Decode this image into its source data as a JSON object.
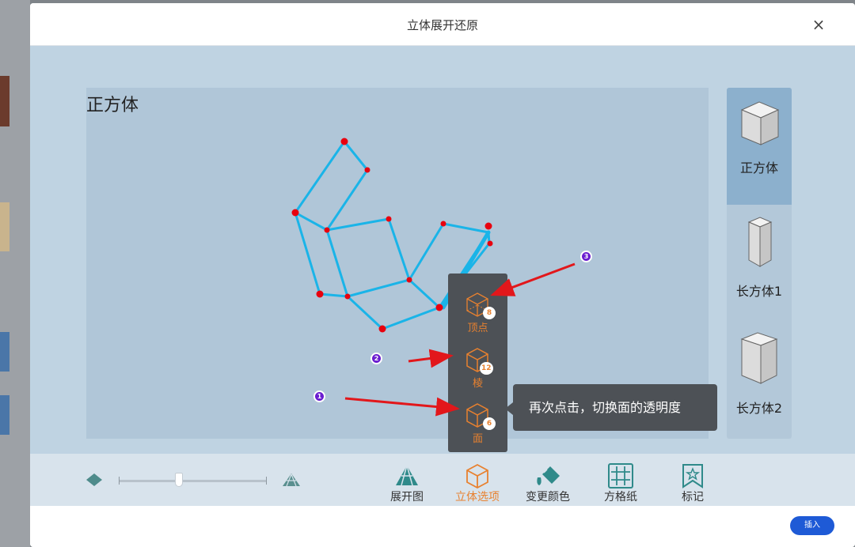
{
  "dialog": {
    "title": "立体展开还原",
    "close_glyph": "×"
  },
  "canvas": {
    "title": "正方体"
  },
  "shapes": [
    {
      "label": "正方体",
      "active": true
    },
    {
      "label": "长方体1",
      "active": false
    },
    {
      "label": "长方体2",
      "active": false
    }
  ],
  "toolbar": {
    "items": [
      {
        "label": "展开图",
        "icon": "unfold-icon"
      },
      {
        "label": "立体选项",
        "icon": "cube-options-icon",
        "active": true
      },
      {
        "label": "变更颜色",
        "icon": "paint-bucket-icon"
      },
      {
        "label": "方格纸",
        "icon": "grid-paper-icon"
      },
      {
        "label": "标记",
        "icon": "bookmark-star-icon"
      }
    ],
    "slider_value": 0.41
  },
  "popup": {
    "items": [
      {
        "label": "顶点",
        "count": "8"
      },
      {
        "label": "棱",
        "count": "12"
      },
      {
        "label": "面",
        "count": "6"
      }
    ]
  },
  "tooltip": {
    "text": "再次点击，切换面的透明度"
  },
  "markers": [
    "1",
    "2",
    "3"
  ],
  "footer": {
    "insert_label": "插入"
  },
  "colors": {
    "accent": "#e8812f",
    "edge": "#1ab4e8",
    "vertex": "#e8000e",
    "primary": "#1e5ad6",
    "annotation": "#6a1dd0"
  }
}
